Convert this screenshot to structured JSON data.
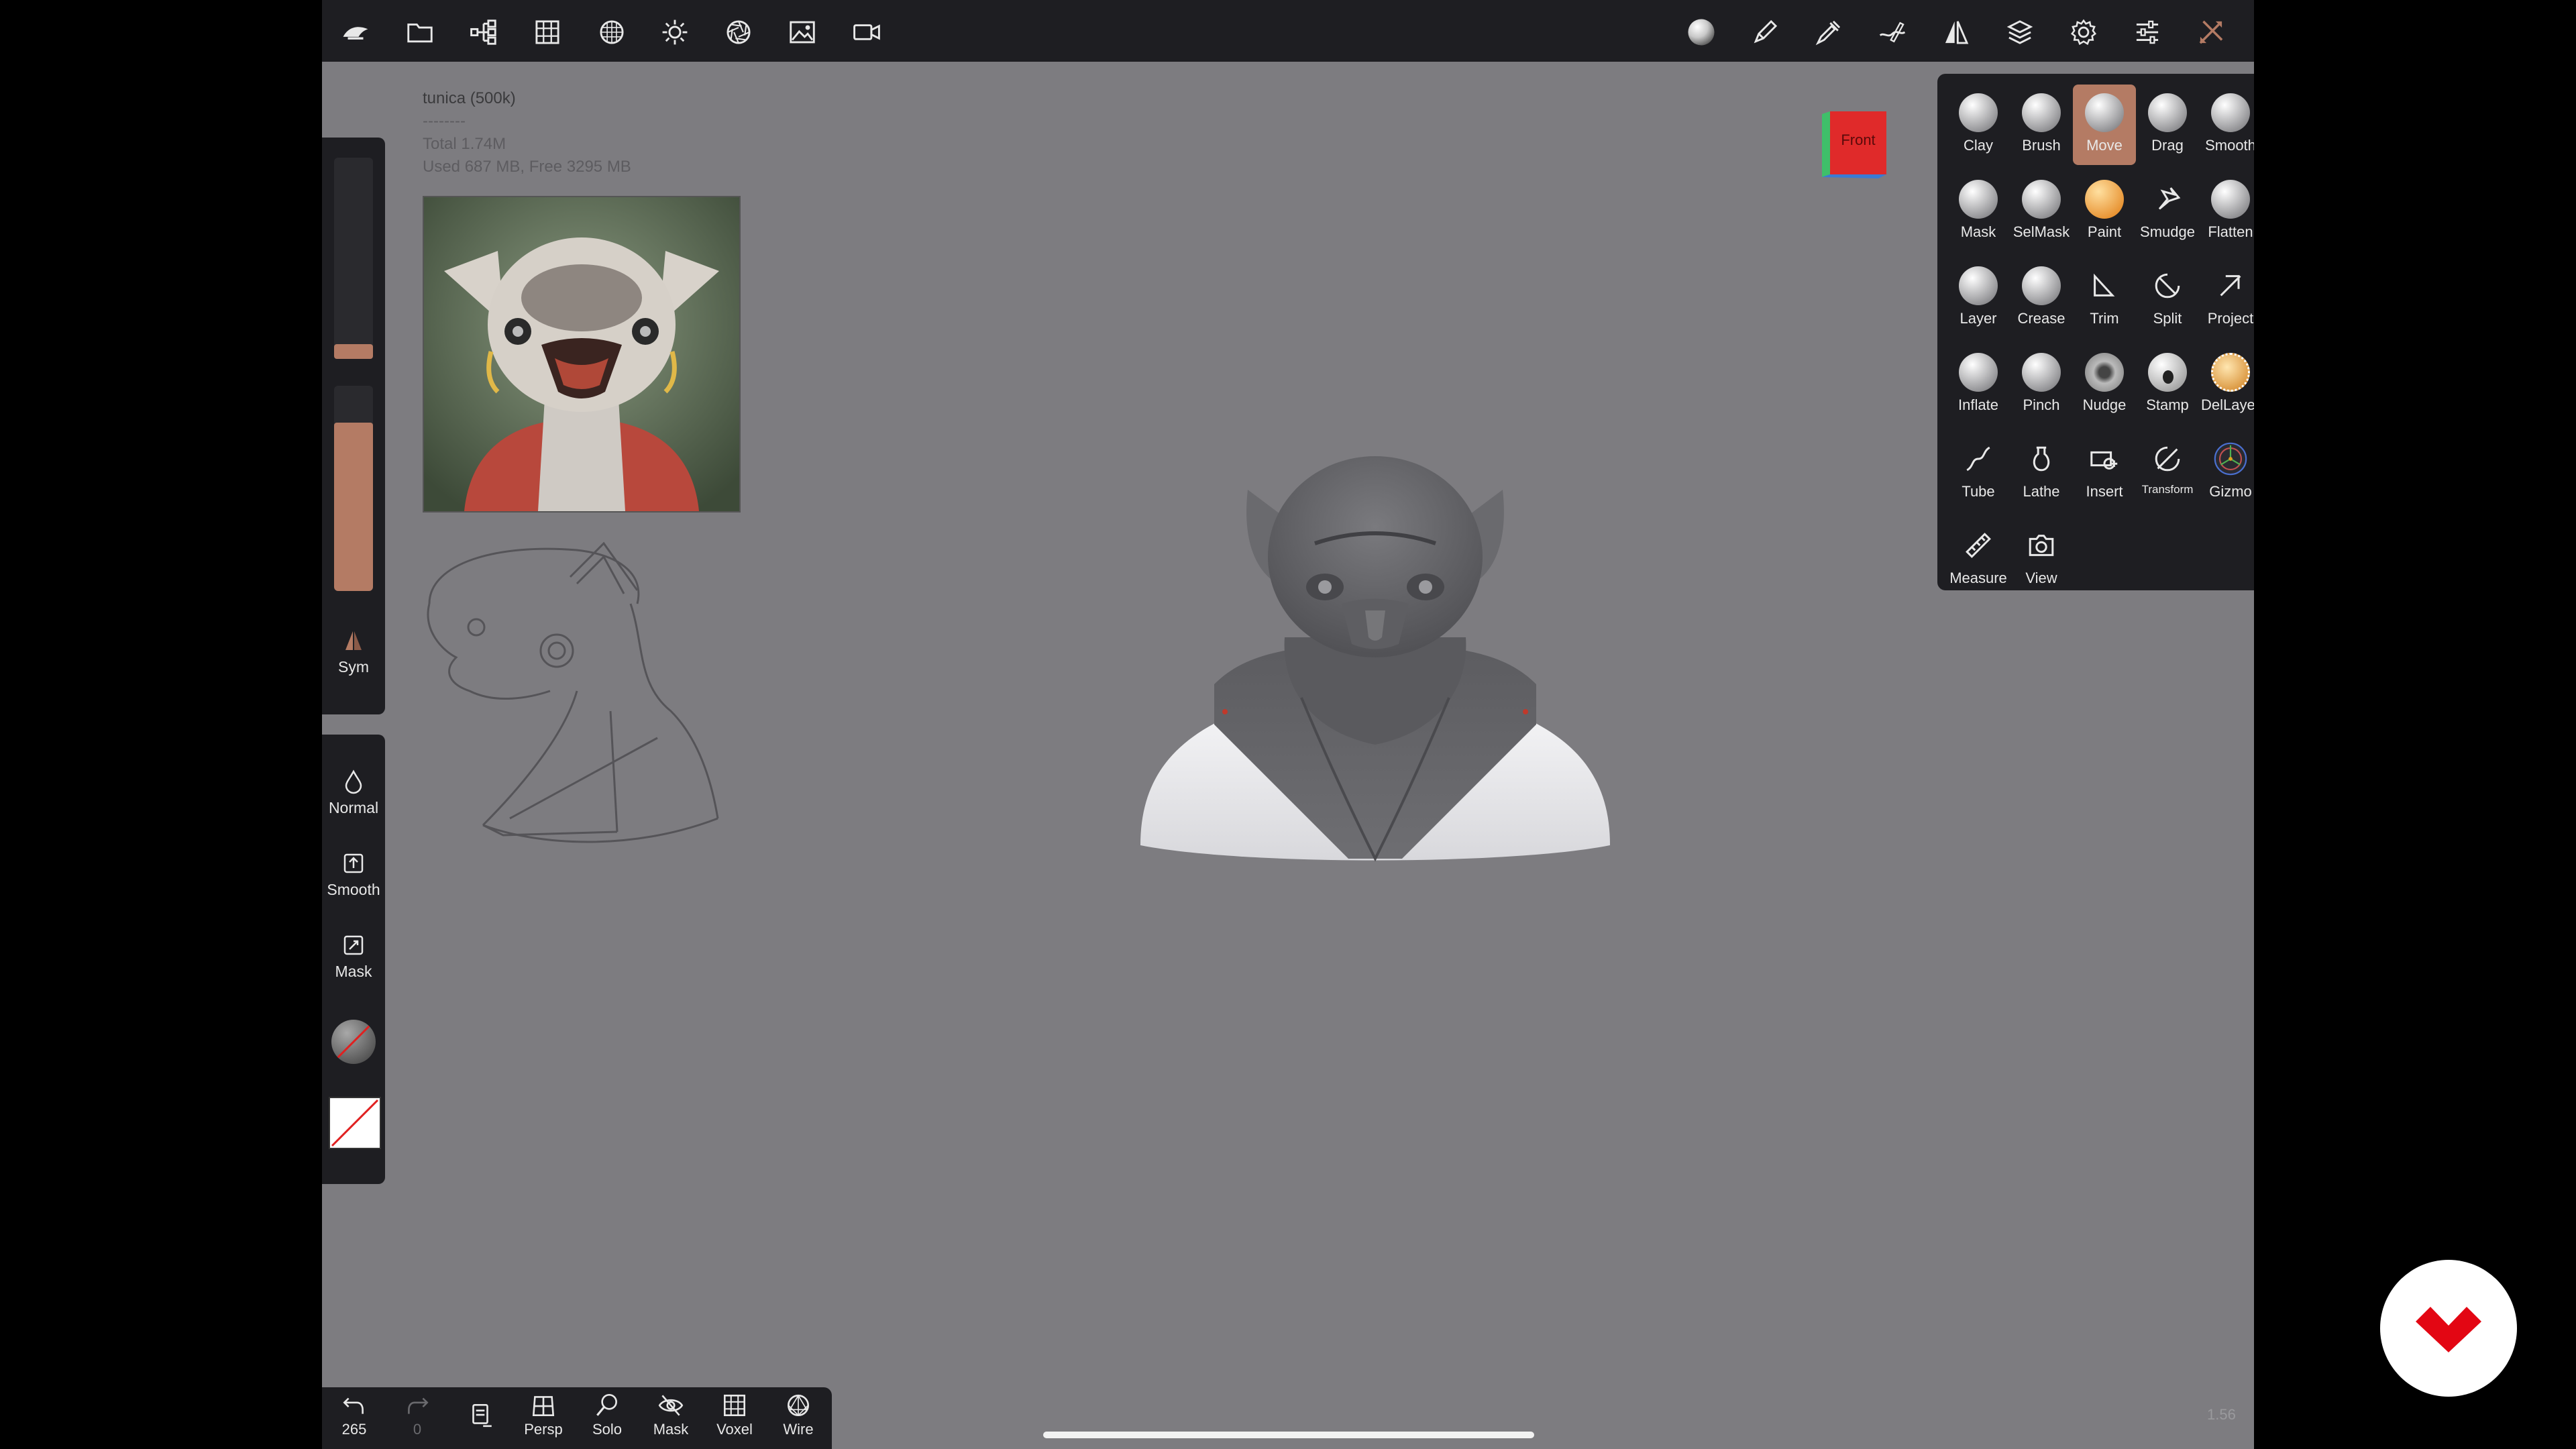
{
  "info": {
    "mesh": "tunica (500k)",
    "divider": "--------",
    "total": "Total 1.74M",
    "memory": "Used 687 MB,  Free 3295 MB"
  },
  "left_panel": {
    "sym_label": "Sym",
    "brush_size_fill": 0.12,
    "brush_intensity_fill": 0.82
  },
  "left_modes": {
    "normal": "Normal",
    "smooth": "Smooth",
    "mask": "Mask"
  },
  "bottom_bar": {
    "undo_count": "265",
    "redo_count": "0",
    "persp": "Persp",
    "solo": "Solo",
    "mask": "Mask",
    "voxel": "Voxel",
    "wire": "Wire"
  },
  "view_cube": {
    "label": "Front"
  },
  "tools": [
    {
      "label": "Clay"
    },
    {
      "label": "Brush"
    },
    {
      "label": "Move"
    },
    {
      "label": "Drag"
    },
    {
      "label": "Smooth"
    },
    {
      "label": "Mask"
    },
    {
      "label": "SelMask"
    },
    {
      "label": "Paint"
    },
    {
      "label": "Smudge"
    },
    {
      "label": "Flatten"
    },
    {
      "label": "Layer"
    },
    {
      "label": "Crease"
    },
    {
      "label": "Trim"
    },
    {
      "label": "Split"
    },
    {
      "label": "Project"
    },
    {
      "label": "Inflate"
    },
    {
      "label": "Pinch"
    },
    {
      "label": "Nudge"
    },
    {
      "label": "Stamp"
    },
    {
      "label": "DelLayer"
    },
    {
      "label": "Tube"
    },
    {
      "label": "Lathe"
    },
    {
      "label": "Insert"
    },
    {
      "label": "Transform"
    },
    {
      "label": "Gizmo"
    },
    {
      "label": "Measure"
    },
    {
      "label": "View"
    }
  ],
  "active_tool": "Move",
  "zoom_readout": "1.56",
  "colors": {
    "panel": "#1e1e22",
    "viewport": "#7d7c80",
    "accent": "#b47b64",
    "logo": "#e30613"
  }
}
